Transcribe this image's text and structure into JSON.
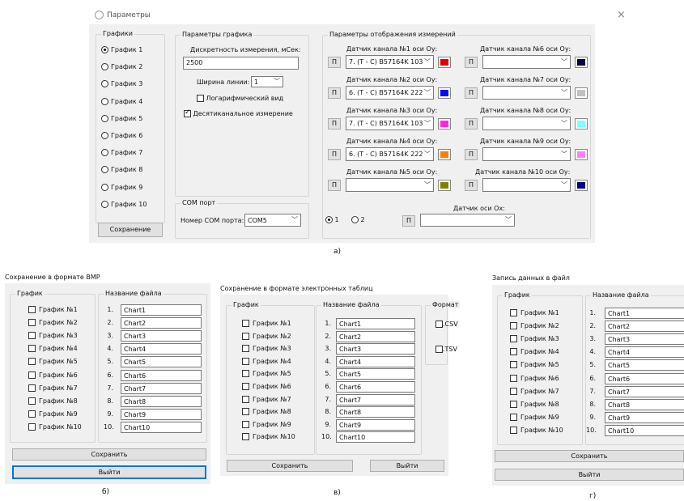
{
  "a": {
    "title": "Параметры",
    "close_glyph": "×",
    "charts_group": "Графики",
    "charts": [
      "График 1",
      "График 2",
      "График 3",
      "График 4",
      "График 5",
      "График 6",
      "График 7",
      "График 8",
      "График 9",
      "График 10"
    ],
    "save_button": "Сохранение",
    "params_group": "Параметры графика",
    "sampling_label": "Дискретность измерения, мСек:",
    "sampling_value": "2500",
    "line_width_label": "Ширина линии:",
    "line_width_value": "1",
    "log_view": "Логарифмический вид",
    "decimal_channel": "Десятиканальное измерение",
    "com_group": "COM порт",
    "com_label": "Номер COM порта:",
    "com_value": "COM5",
    "display_group": "Параметры отображения измерений",
    "channels": [
      {
        "label": "Датчик канала №1 оси Оу:",
        "value": "7. (T - C) B57164K 103",
        "color": "#e00000"
      },
      {
        "label": "Датчик канала №2 оси Оу:",
        "value": "6. (T - C) B57164K 222",
        "color": "#0010ff"
      },
      {
        "label": "Датчик канала №3 оси Оу:",
        "value": "7. (T - C) B57164K 103",
        "color": "#ff28e0"
      },
      {
        "label": "Датчик канала №4 оси Оу:",
        "value": "6. (T - C) B57164K 222",
        "color": "#ff8000"
      },
      {
        "label": "Датчик канала №5 оси Оу:",
        "value": "",
        "color": "#808000"
      },
      {
        "label": "Датчик канала №6 оси Оу:",
        "value": "",
        "color": "#000040"
      },
      {
        "label": "Датчик канала №7 оси Оу:",
        "value": "",
        "color": "#c0c0c0"
      },
      {
        "label": "Датчик канала №8 оси Оу:",
        "value": "",
        "color": "#80ffff"
      },
      {
        "label": "Датчик канала №9 оси Оу:",
        "value": "",
        "color": "#ff80ff"
      },
      {
        "label": "Датчик канала №10 оси Оу:",
        "value": "",
        "color": "#000080"
      }
    ],
    "p_button": "П",
    "radio1": "1",
    "radio2": "2",
    "x_sensor_label": "Датчик оси Ох:",
    "x_sensor_value": "",
    "caption": "а)"
  },
  "b": {
    "title": "Сохранение в формате BMP",
    "chart_group": "График",
    "file_group": "Название файла",
    "charts": [
      "График №1",
      "График №2",
      "График №3",
      "График №4",
      "График №5",
      "График №6",
      "График №7",
      "График №8",
      "График №9",
      "График №10"
    ],
    "nums": [
      "1.",
      "2.",
      "3.",
      "4.",
      "5.",
      "6.",
      "7.",
      "8.",
      "9.",
      "10."
    ],
    "files": [
      "Chart1",
      "Chart2",
      "Chart3",
      "Chart4",
      "Chart5",
      "Chart6",
      "Chart7",
      "Chart8",
      "Chart9",
      "Chart10"
    ],
    "save": "Сохранить",
    "exit": "Выйти",
    "caption": "б)"
  },
  "c": {
    "title": "Сохранение в формате электронных таблиц",
    "chart_group": "График",
    "file_group": "Название файла",
    "format_group": "Формат",
    "csv": ".CSV",
    "tsv": ".TSV",
    "charts": [
      "График №1",
      "График №2",
      "График №3",
      "График №4",
      "График №5",
      "График №6",
      "График №7",
      "График №8",
      "График №9",
      "График №10"
    ],
    "nums": [
      "1.",
      "2.",
      "3.",
      "4.",
      "5.",
      "6.",
      "7.",
      "8.",
      "9.",
      "10."
    ],
    "files": [
      "Chart1",
      "Chart2",
      "Chart3",
      "Chart4",
      "Chart5",
      "Chart6",
      "Chart7",
      "Chart8",
      "Chart9",
      "Chart10"
    ],
    "save": "Сохранить",
    "exit": "Выйти",
    "caption": "в)"
  },
  "d": {
    "title": "Запись данных в файл",
    "chart_group": "График",
    "file_group": "Название файла",
    "charts": [
      "График №1",
      "График №2",
      "График №3",
      "График №4",
      "График №5",
      "График №6",
      "График №7",
      "График №8",
      "График №9",
      "График №10"
    ],
    "nums": [
      "1.",
      "2.",
      "3.",
      "4.",
      "5.",
      "6.",
      "7.",
      "8.",
      "9.",
      "10."
    ],
    "files": [
      "Chart1",
      "Chart2",
      "Chart3",
      "Chart4",
      "Chart5",
      "Chart6",
      "Chart7",
      "Chart8",
      "Chart9",
      "Chart10"
    ],
    "save": "Сохранить",
    "exit": "Выйти",
    "caption": "г)"
  }
}
